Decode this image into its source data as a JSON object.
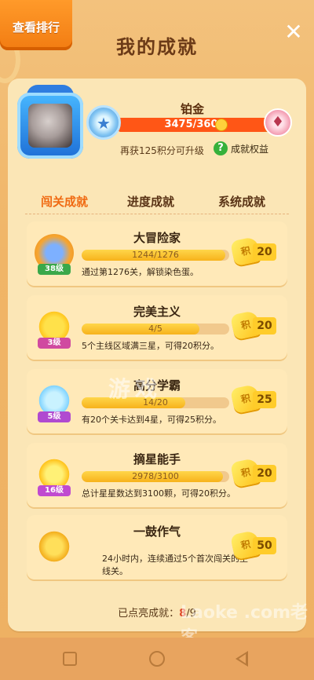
{
  "header": {
    "rank_tab_label": "查看排行",
    "title": "我的成就",
    "close_icon": "close-icon"
  },
  "profile": {
    "rank_name": "铂金",
    "score_text": "3475/3600",
    "score_progress": 0.965,
    "upgrade_hint": "再获125积分可升级",
    "rights_label": "成就权益"
  },
  "tabs": [
    {
      "label": "闯关成就",
      "active": true
    },
    {
      "label": "进度成就",
      "active": false
    },
    {
      "label": "系统成就",
      "active": false
    }
  ],
  "achievements": [
    {
      "title": "大冒险家",
      "level": "38级",
      "progress_text": "1244/1276",
      "progress": 0.975,
      "description": "通过第1276关，解锁染色蛋。",
      "reward": "20",
      "icon": "treasure-medal-icon",
      "level_color": "#3aa84a"
    },
    {
      "title": "完美主义",
      "level": "3级",
      "progress_text": "4/5",
      "progress": 0.8,
      "description": "5个主线区域满三星，可得20积分。",
      "reward": "20",
      "icon": "winged-star-icon",
      "level_color": "#d04aa0"
    },
    {
      "title": "高分学霸",
      "level": "5级",
      "progress_text": "14/20",
      "progress": 0.7,
      "description": "有20个关卡达到4星，可得25积分。",
      "reward": "25",
      "icon": "crystal-star-icon",
      "level_color": "#b04ad0"
    },
    {
      "title": "摘星能手",
      "level": "16级",
      "progress_text": "2978/3100",
      "progress": 0.96,
      "description": "总计星星数达到3100颗，可得20积分。",
      "reward": "20",
      "icon": "star-trophy-icon",
      "level_color": "#c04ad0"
    },
    {
      "title": "一鼓作气",
      "level": "",
      "progress_text": "",
      "progress": null,
      "description": "24小时内，连续通过5个首次闯关的主线关。",
      "reward": "50",
      "icon": "rocket-trophy-icon",
      "level_color": ""
    }
  ],
  "reward_badge_label": "积",
  "footer": {
    "label": "已点亮成就：",
    "lit": "8",
    "total": "/9"
  },
  "watermark": "Laoke .com老客",
  "watermark_center": "游戏"
}
